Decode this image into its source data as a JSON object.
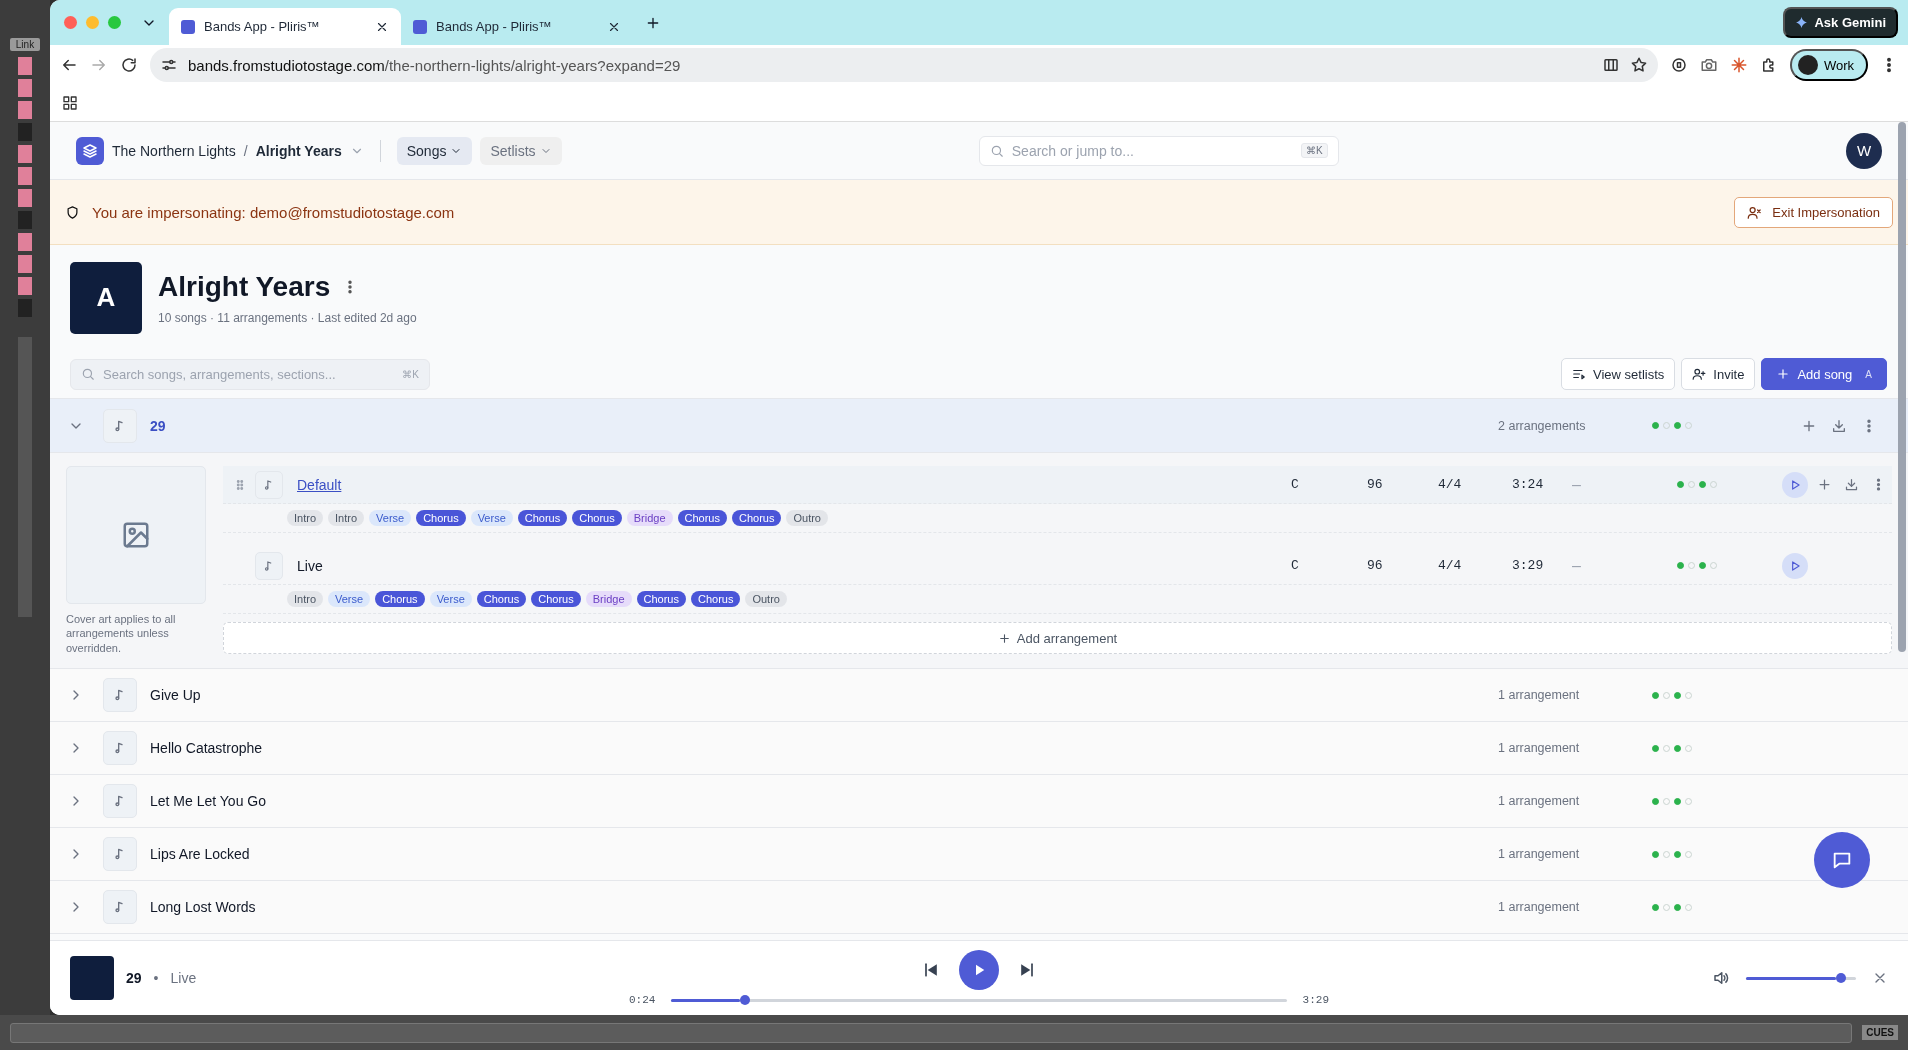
{
  "desktop": {
    "link_label": "Link",
    "cues_label": "CUES"
  },
  "browser": {
    "tabs": [
      {
        "title": "Bands App - Pliris™",
        "selected": true
      },
      {
        "title": "Bands App - Pliris™",
        "selected": false
      }
    ],
    "gemini": "Ask Gemini",
    "url_host": "bands.fromstudiotostage.com",
    "url_path": "/the-northern-lights/alright-years?expand=29",
    "profile": "Work"
  },
  "header": {
    "breadcrumb": [
      "The Northern Lights",
      "Alright Years"
    ],
    "breadcrumb_separator": "/",
    "nav": [
      {
        "label": "Songs",
        "selected": true
      },
      {
        "label": "Setlists",
        "selected": false
      }
    ],
    "search": {
      "placeholder": "Search or jump to...",
      "shortcut": "⌘K"
    },
    "avatar": "W"
  },
  "banner": {
    "text": "You are impersonating: demo@fromstudiotostage.com",
    "button": "Exit Impersonation"
  },
  "album": {
    "initial": "A",
    "title": "Alright Years",
    "meta": "10 songs · 11 arrangements · Last edited 2d ago"
  },
  "toolbar": {
    "search": {
      "placeholder": "Search songs, arrangements, sections...",
      "shortcut": "⌘K"
    },
    "buttons": [
      {
        "kind": "setlists",
        "label": "View setlists"
      },
      {
        "kind": "invite",
        "label": "Invite"
      },
      {
        "kind": "add",
        "label": "Add song",
        "shortcut": "A"
      }
    ]
  },
  "songs": [
    {
      "title": "29",
      "expanded": true,
      "count": "2 arrangements",
      "stages": [
        {
          "done": true
        },
        {
          "done": false
        },
        {
          "done": true
        },
        {
          "done": false
        }
      ],
      "cover_note": "Cover art applies to all arrangements unless overridden.",
      "add_label": "Add arrangement",
      "arrangements": [
        {
          "name": "Default",
          "hovered": true,
          "key": "C",
          "tempo": "96",
          "meter": "4/4",
          "duration": "3:24",
          "column_5": "–",
          "stages": [
            {
              "done": true
            },
            {
              "done": false
            },
            {
              "done": true
            },
            {
              "done": false
            }
          ],
          "sections": [
            {
              "label": "Intro",
              "kind": "intro"
            },
            {
              "label": "Intro",
              "kind": "intro"
            },
            {
              "label": "Verse",
              "kind": "verse"
            },
            {
              "label": "Chorus",
              "kind": "chorus"
            },
            {
              "label": "Verse",
              "kind": "verse"
            },
            {
              "label": "Chorus",
              "kind": "chorus"
            },
            {
              "label": "Chorus",
              "kind": "chorus"
            },
            {
              "label": "Bridge",
              "kind": "bridge"
            },
            {
              "label": "Chorus",
              "kind": "chorus"
            },
            {
              "label": "Chorus",
              "kind": "chorus"
            },
            {
              "label": "Outro",
              "kind": "outro"
            }
          ]
        },
        {
          "name": "Live",
          "hovered": false,
          "key": "C",
          "tempo": "96",
          "meter": "4/4",
          "duration": "3:29",
          "column_5": "–",
          "stages": [
            {
              "done": true
            },
            {
              "done": false
            },
            {
              "done": true
            },
            {
              "done": false
            }
          ],
          "sections": [
            {
              "label": "Intro",
              "kind": "intro"
            },
            {
              "label": "Verse",
              "kind": "verse"
            },
            {
              "label": "Chorus",
              "kind": "chorus"
            },
            {
              "label": "Verse",
              "kind": "verse"
            },
            {
              "label": "Chorus",
              "kind": "chorus"
            },
            {
              "label": "Chorus",
              "kind": "chorus"
            },
            {
              "label": "Bridge",
              "kind": "bridge"
            },
            {
              "label": "Chorus",
              "kind": "chorus"
            },
            {
              "label": "Chorus",
              "kind": "chorus"
            },
            {
              "label": "Outro",
              "kind": "outro"
            }
          ]
        }
      ]
    },
    {
      "title": "Give Up",
      "expanded": false,
      "count": "1 arrangement",
      "stages": [
        {
          "done": true
        },
        {
          "done": false
        },
        {
          "done": true
        },
        {
          "done": false
        }
      ]
    },
    {
      "title": "Hello Catastrophe",
      "expanded": false,
      "count": "1 arrangement",
      "stages": [
        {
          "done": true
        },
        {
          "done": false
        },
        {
          "done": true
        },
        {
          "done": false
        }
      ]
    },
    {
      "title": "Let Me Let You Go",
      "expanded": false,
      "count": "1 arrangement",
      "stages": [
        {
          "done": true
        },
        {
          "done": false
        },
        {
          "done": true
        },
        {
          "done": false
        }
      ]
    },
    {
      "title": "Lips Are Locked",
      "expanded": false,
      "count": "1 arrangement",
      "stages": [
        {
          "done": true
        },
        {
          "done": false
        },
        {
          "done": true
        },
        {
          "done": false
        }
      ]
    },
    {
      "title": "Long Lost Words",
      "expanded": false,
      "count": "1 arrangement",
      "stages": [
        {
          "done": true
        },
        {
          "done": false
        },
        {
          "done": true
        },
        {
          "done": false
        }
      ]
    }
  ],
  "player": {
    "title": "29",
    "separator": "•",
    "arrangement": "Live",
    "elapsed": "0:24",
    "total": "3:29",
    "progress": {
      "level": 0.12
    },
    "volume": {
      "level": 0.86
    }
  }
}
